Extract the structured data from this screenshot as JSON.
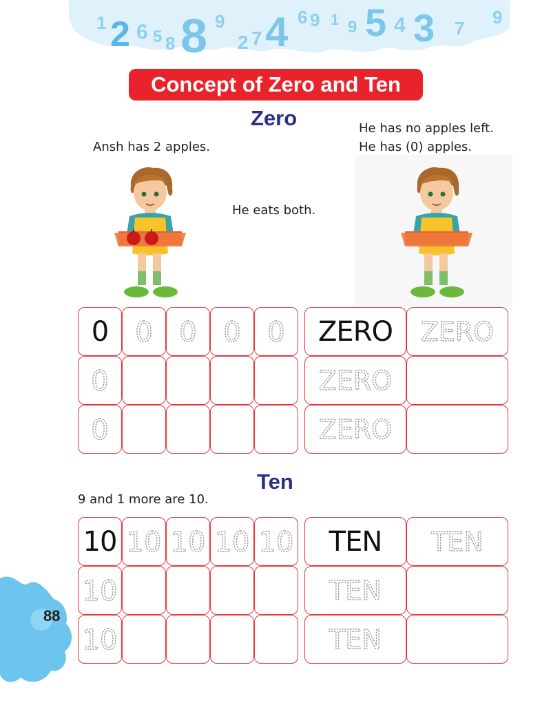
{
  "header": {
    "splash_digits": [
      "1",
      "2",
      "6",
      "5",
      "8",
      "8",
      "9",
      "2",
      "7",
      "4",
      "6",
      "9",
      "1",
      "9",
      "5",
      "4",
      "3",
      "7",
      "9"
    ],
    "title": "Concept of Zero and Ten"
  },
  "zero_section": {
    "heading": "Zero",
    "line_before": "Ansh has 2 apples.",
    "line_middle": "He eats both.",
    "line_after_1": "He has no apples left.",
    "line_after_2": "He has (0) apples.",
    "apple_count_before": 2,
    "apple_count_after": 0,
    "numeral_model": "0",
    "word_model": "ZERO",
    "numeral_trace": "0",
    "word_trace": "ZERO"
  },
  "ten_section": {
    "heading": "Ten",
    "intro": "9 and 1 more are 10.",
    "numeral_model": "10",
    "word_model": "TEN",
    "numeral_trace": "10",
    "word_trace": "TEN"
  },
  "footer": {
    "page_number": "88"
  },
  "colors": {
    "title_red": "#e8232b",
    "heading_blue": "#2b2f86",
    "cell_border": "#e8353b",
    "splash_blue": "#8fd0ee",
    "trace_gray": "#9a9a9a"
  }
}
